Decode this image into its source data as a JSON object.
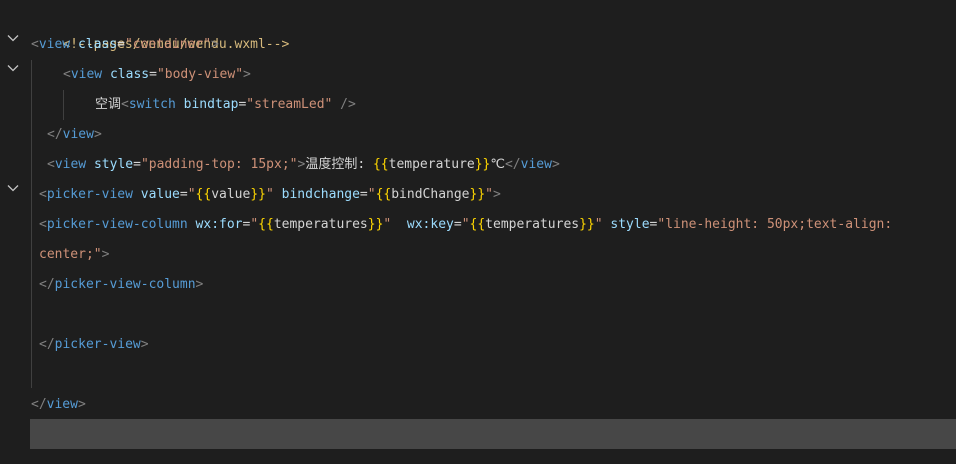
{
  "editor": {
    "file_comment": "<!--pages/wendu/wendu.wxml-->",
    "lines": {
      "l2": {
        "open": "<",
        "tag": "view",
        "attr": " class",
        "eq": "=",
        "str": "\"container\"",
        "close": ">"
      },
      "l3": {
        "open": "<",
        "tag": "view",
        "attr": " class",
        "eq": "=",
        "str": "\"body-view\"",
        "close": ">"
      },
      "l4": {
        "text": "空调",
        "open": "<",
        "tag": "switch",
        "attr": " bindtap",
        "eq": "=",
        "str": "\"streamLed\"",
        "close": " />"
      },
      "l5": {
        "open": "</",
        "tag": "view",
        "close": ">"
      },
      "l6": {
        "open": "<",
        "tag": "view",
        "attr": " style",
        "eq": "=",
        "str": "\"padding-top: 15px;\"",
        "gt": ">",
        "text": "温度控制: ",
        "brace_open": "{{",
        "expr": "temperature",
        "brace_close": "}}",
        "unit": "℃",
        "end_open": "</",
        "end_tag": "view",
        "end_close": ">"
      },
      "l7": {
        "open": "<",
        "tag": "picker-view",
        "attr1": " value",
        "eq1": "=",
        "q1": "\"",
        "b1o": "{{",
        "e1": "value",
        "b1c": "}}",
        "q1c": "\"",
        "attr2": " bindchange",
        "eq2": "=",
        "q2": "\"",
        "b2o": "{{",
        "e2": "bindChange",
        "b2c": "}}",
        "q2c": "\"",
        "close": ">"
      },
      "l8": {
        "open": "<",
        "tag": "picker-view-column",
        "attr1": " wx:for",
        "eq1": "=",
        "q1": "\"",
        "b1o": "{{",
        "e1": "temperatures",
        "b1c": "}}",
        "q1c": "\"",
        "attr2": "  wx:key",
        "eq2": "=",
        "q2": "\"",
        "b2o": "{{",
        "e2": "temperatures",
        "b2c": "}}",
        "q2c": "\"",
        "attr3": " style",
        "eq3": "=",
        "str3": "\"line-height: 50px;text-align:"
      },
      "l9": {
        "str": "center;\"",
        "close": ">"
      },
      "l10": {
        "open": "</",
        "tag": "picker-view-column",
        "close": ">"
      },
      "l12": {
        "open": "</",
        "tag": "picker-view",
        "close": ">"
      },
      "l14": {
        "open": "</",
        "tag": "view",
        "close": ">"
      }
    },
    "fold_icon": "chevron-down-icon"
  }
}
